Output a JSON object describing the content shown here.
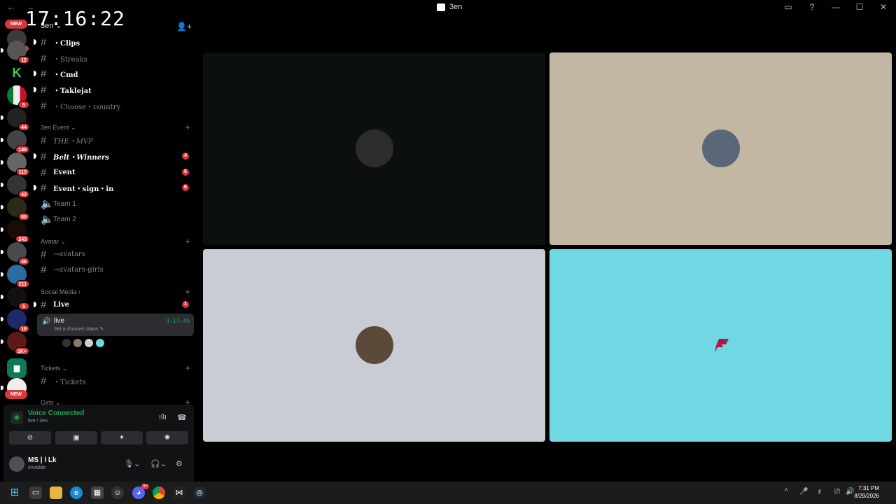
{
  "window": {
    "title": "3en",
    "nav_label": "← →",
    "controls": [
      "▭",
      "?",
      "—",
      "☐",
      "✕"
    ]
  },
  "overlay_clock": "17:16:22",
  "rail": {
    "new_top": "NEW",
    "new_bottom": "NEW",
    "badges": [
      "69",
      "12",
      "5",
      "44",
      "189",
      "113",
      "43",
      "85",
      "243",
      "46",
      "211",
      "5",
      "19",
      "1K+"
    ]
  },
  "guild": {
    "name": "3en",
    "invite_icon": "add-user-icon"
  },
  "channels_top": [
    {
      "name": "・Clips",
      "bright": true
    },
    {
      "name": "・Streaks",
      "bright": false
    },
    {
      "name": "・Cmd",
      "bright": true
    },
    {
      "name": "・Taklejat",
      "bright": true
    },
    {
      "name": "・Choose・country",
      "bright": false
    }
  ],
  "categories": {
    "event": "3en Event ⌄",
    "avatar": "Avatar ⌄",
    "social": "Social Media ›",
    "tickets": "Tickets ⌄",
    "girls": "Girls ⌄"
  },
  "channels_event": [
    {
      "name": "THE・MVP",
      "bright": false,
      "mention": ""
    },
    {
      "name": "Belt・Winners",
      "bright": true,
      "mention": "4"
    },
    {
      "name": "Event",
      "bright": true,
      "mention": "5"
    },
    {
      "name": "Event・sign・in",
      "bright": true,
      "mention": "6"
    }
  ],
  "voice_channels": [
    "Team 1",
    "Team 2"
  ],
  "channels_avatar": [
    "→avatars",
    "→avatars-girls"
  ],
  "channel_live_text": {
    "name": "Live",
    "mention": "1"
  },
  "live_voice": {
    "name": "live",
    "status": "Set a channel status ✎",
    "time": "3:17:49"
  },
  "channels_tickets": [
    "・Tickets"
  ],
  "voice_panel": {
    "state": "Voice Connected",
    "location": "live / 3en",
    "buttons": [
      "camera-off-icon",
      "screen-share-icon",
      "activities-icon",
      "soundboard-icon"
    ]
  },
  "user": {
    "name": "MS | l Lk",
    "status": "Invisible"
  },
  "tiles": [
    {
      "bg": "#0c0f10",
      "avatar": "#2c2c2c"
    },
    {
      "bg": "#c2b7a2",
      "avatar": "#5a6778"
    },
    {
      "bg": "#c9ccd4",
      "avatar": "#5b4a3a"
    },
    {
      "bg": "#6fd8e2",
      "avatar": "#b0184a"
    }
  ],
  "taskbar": {
    "time": "7:31 PM",
    "date": "8/29/2026",
    "discord_badge": "9+",
    "tray": [
      "^",
      "🎤",
      "ε",
      "⎚",
      "🔊"
    ]
  }
}
